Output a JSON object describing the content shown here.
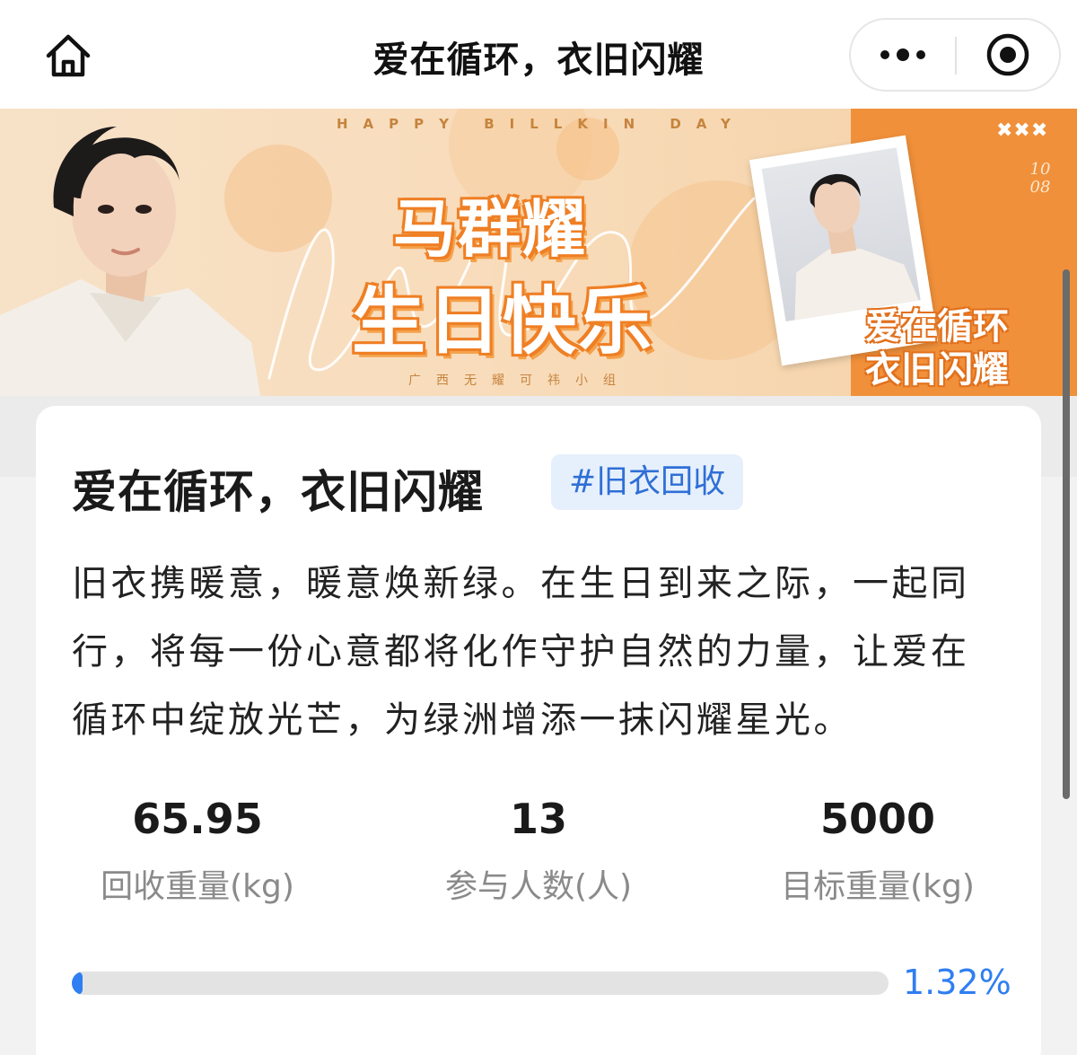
{
  "header": {
    "title": "爱在循环，衣旧闪耀",
    "home_icon": "home-icon",
    "more_icon": "more-dots-icon",
    "close_icon": "target-close-icon"
  },
  "banner": {
    "tagline": "HAPPY BILLKIN DAY",
    "headline_line1": "马群耀",
    "headline_line2": "生日快乐",
    "group_name": "广西无耀可祎小组",
    "slogan_line1": "爱在循环",
    "slogan_line2": "衣旧闪耀",
    "date_top": "10",
    "date_bottom": "08",
    "x_mark": "✖✖✖",
    "colors": {
      "orange": "#f0903a",
      "peach": "#f7e2c8"
    }
  },
  "card": {
    "title": "爱在循环，衣旧闪耀",
    "topic_tag": "#旧衣回收",
    "description": "旧衣携暖意，暖意焕新绿。在生日到来之际，一起同行，将每一份心意都将化作守护自然的力量，让爱在循环中绽放光芒，为绿洲增添一抹闪耀星光。"
  },
  "stats": [
    {
      "value": "65.95",
      "label": "回收重量(kg)"
    },
    {
      "value": "13",
      "label": "参与人数(人)"
    },
    {
      "value": "5000",
      "label": "目标重量(kg)"
    }
  ],
  "progress": {
    "percent_text": "1.32%",
    "fraction": 0.0132,
    "color": "#2f7ef2"
  }
}
